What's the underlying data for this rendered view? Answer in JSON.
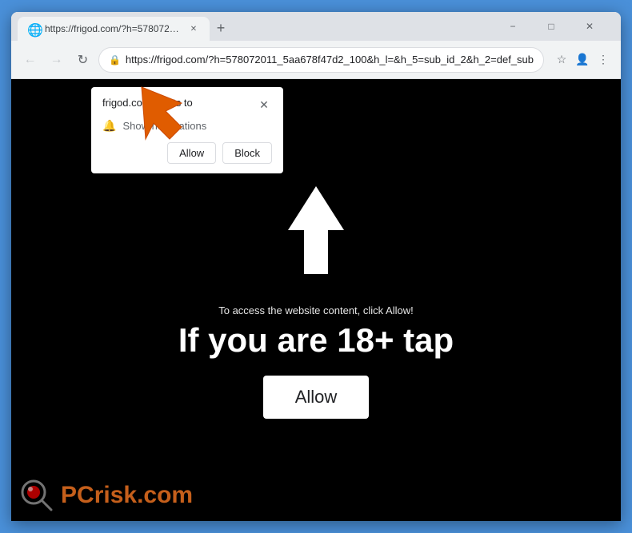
{
  "browser": {
    "tab": {
      "title": "https://frigod.com/?h=57807201...",
      "favicon": "🌐"
    },
    "window_controls": {
      "minimize": "−",
      "maximize": "□",
      "close": "✕"
    },
    "address_bar": {
      "url": "https://frigod.com/?h=578072011_5aa678f47d2_100&h_l=&h_5=sub_id_2&h_2=def_sub",
      "lock_icon": "🔒"
    },
    "new_tab_icon": "+",
    "back_icon": "←",
    "forward_icon": "→",
    "refresh_icon": "↻",
    "star_icon": "☆",
    "account_icon": "👤",
    "menu_icon": "⋮"
  },
  "notification_popup": {
    "title": "frigod.com wants to",
    "close_label": "✕",
    "notification_text": "Show notifications",
    "allow_label": "Allow",
    "block_label": "Block"
  },
  "website": {
    "small_text": "To access the website content, click Allow!",
    "large_text": "If you are 18+ tap",
    "allow_button_label": "Allow"
  },
  "watermark": {
    "text_gray": "risk.com",
    "text_orange": "PC"
  },
  "colors": {
    "orange_arrow": "#e05c00",
    "browser_chrome": "#f1f3f4",
    "tab_bar": "#dee1e6",
    "accent_blue": "#4a90d9",
    "website_bg": "#000000",
    "white": "#ffffff"
  }
}
